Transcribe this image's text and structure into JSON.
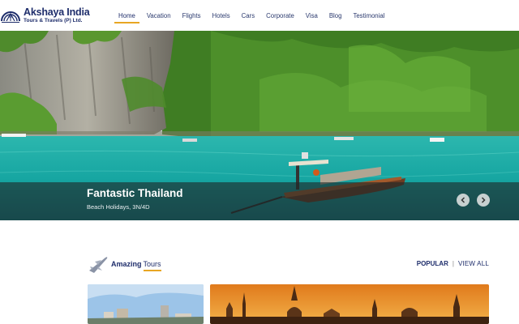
{
  "brand": {
    "name": "Akshaya India",
    "subtitle": "Tours & Travels (P) Ltd."
  },
  "nav": {
    "items": [
      {
        "label": "Home",
        "active": true
      },
      {
        "label": "Vacation",
        "active": false
      },
      {
        "label": "Flights",
        "active": false
      },
      {
        "label": "Hotels",
        "active": false
      },
      {
        "label": "Cars",
        "active": false
      },
      {
        "label": "Corporate",
        "active": false
      },
      {
        "label": "Visa",
        "active": false
      },
      {
        "label": "Blog",
        "active": false
      },
      {
        "label": "Testimonial",
        "active": false
      }
    ]
  },
  "hero": {
    "title": "Fantastic Thailand",
    "subtitle": "Beach Holidays, 3N/4D",
    "prev_icon": "chevron-left-icon",
    "next_icon": "chevron-right-icon"
  },
  "tours": {
    "heading_bold": "Amazing",
    "heading_light": "Tours",
    "filter_popular": "POPULAR",
    "separator": "|",
    "filter_view_all": "VIEW ALL",
    "icon": "airplane-icon"
  },
  "colors": {
    "brand_navy": "#1e2d6b",
    "accent_orange": "#e8a623",
    "sea": "#1fb0a8"
  }
}
